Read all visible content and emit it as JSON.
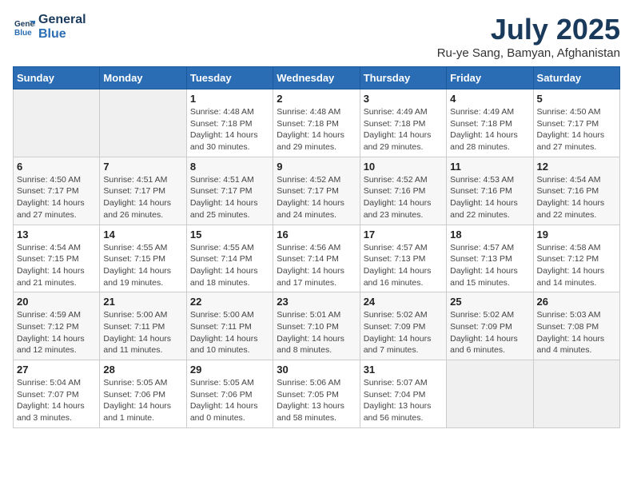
{
  "header": {
    "logo_line1": "General",
    "logo_line2": "Blue",
    "title": "July 2025",
    "subtitle": "Ru-ye Sang, Bamyan, Afghanistan"
  },
  "weekdays": [
    "Sunday",
    "Monday",
    "Tuesday",
    "Wednesday",
    "Thursday",
    "Friday",
    "Saturday"
  ],
  "weeks": [
    [
      {
        "num": "",
        "detail": ""
      },
      {
        "num": "",
        "detail": ""
      },
      {
        "num": "1",
        "detail": "Sunrise: 4:48 AM\nSunset: 7:18 PM\nDaylight: 14 hours\nand 30 minutes."
      },
      {
        "num": "2",
        "detail": "Sunrise: 4:48 AM\nSunset: 7:18 PM\nDaylight: 14 hours\nand 29 minutes."
      },
      {
        "num": "3",
        "detail": "Sunrise: 4:49 AM\nSunset: 7:18 PM\nDaylight: 14 hours\nand 29 minutes."
      },
      {
        "num": "4",
        "detail": "Sunrise: 4:49 AM\nSunset: 7:18 PM\nDaylight: 14 hours\nand 28 minutes."
      },
      {
        "num": "5",
        "detail": "Sunrise: 4:50 AM\nSunset: 7:17 PM\nDaylight: 14 hours\nand 27 minutes."
      }
    ],
    [
      {
        "num": "6",
        "detail": "Sunrise: 4:50 AM\nSunset: 7:17 PM\nDaylight: 14 hours\nand 27 minutes."
      },
      {
        "num": "7",
        "detail": "Sunrise: 4:51 AM\nSunset: 7:17 PM\nDaylight: 14 hours\nand 26 minutes."
      },
      {
        "num": "8",
        "detail": "Sunrise: 4:51 AM\nSunset: 7:17 PM\nDaylight: 14 hours\nand 25 minutes."
      },
      {
        "num": "9",
        "detail": "Sunrise: 4:52 AM\nSunset: 7:17 PM\nDaylight: 14 hours\nand 24 minutes."
      },
      {
        "num": "10",
        "detail": "Sunrise: 4:52 AM\nSunset: 7:16 PM\nDaylight: 14 hours\nand 23 minutes."
      },
      {
        "num": "11",
        "detail": "Sunrise: 4:53 AM\nSunset: 7:16 PM\nDaylight: 14 hours\nand 22 minutes."
      },
      {
        "num": "12",
        "detail": "Sunrise: 4:54 AM\nSunset: 7:16 PM\nDaylight: 14 hours\nand 22 minutes."
      }
    ],
    [
      {
        "num": "13",
        "detail": "Sunrise: 4:54 AM\nSunset: 7:15 PM\nDaylight: 14 hours\nand 21 minutes."
      },
      {
        "num": "14",
        "detail": "Sunrise: 4:55 AM\nSunset: 7:15 PM\nDaylight: 14 hours\nand 19 minutes."
      },
      {
        "num": "15",
        "detail": "Sunrise: 4:55 AM\nSunset: 7:14 PM\nDaylight: 14 hours\nand 18 minutes."
      },
      {
        "num": "16",
        "detail": "Sunrise: 4:56 AM\nSunset: 7:14 PM\nDaylight: 14 hours\nand 17 minutes."
      },
      {
        "num": "17",
        "detail": "Sunrise: 4:57 AM\nSunset: 7:13 PM\nDaylight: 14 hours\nand 16 minutes."
      },
      {
        "num": "18",
        "detail": "Sunrise: 4:57 AM\nSunset: 7:13 PM\nDaylight: 14 hours\nand 15 minutes."
      },
      {
        "num": "19",
        "detail": "Sunrise: 4:58 AM\nSunset: 7:12 PM\nDaylight: 14 hours\nand 14 minutes."
      }
    ],
    [
      {
        "num": "20",
        "detail": "Sunrise: 4:59 AM\nSunset: 7:12 PM\nDaylight: 14 hours\nand 12 minutes."
      },
      {
        "num": "21",
        "detail": "Sunrise: 5:00 AM\nSunset: 7:11 PM\nDaylight: 14 hours\nand 11 minutes."
      },
      {
        "num": "22",
        "detail": "Sunrise: 5:00 AM\nSunset: 7:11 PM\nDaylight: 14 hours\nand 10 minutes."
      },
      {
        "num": "23",
        "detail": "Sunrise: 5:01 AM\nSunset: 7:10 PM\nDaylight: 14 hours\nand 8 minutes."
      },
      {
        "num": "24",
        "detail": "Sunrise: 5:02 AM\nSunset: 7:09 PM\nDaylight: 14 hours\nand 7 minutes."
      },
      {
        "num": "25",
        "detail": "Sunrise: 5:02 AM\nSunset: 7:09 PM\nDaylight: 14 hours\nand 6 minutes."
      },
      {
        "num": "26",
        "detail": "Sunrise: 5:03 AM\nSunset: 7:08 PM\nDaylight: 14 hours\nand 4 minutes."
      }
    ],
    [
      {
        "num": "27",
        "detail": "Sunrise: 5:04 AM\nSunset: 7:07 PM\nDaylight: 14 hours\nand 3 minutes."
      },
      {
        "num": "28",
        "detail": "Sunrise: 5:05 AM\nSunset: 7:06 PM\nDaylight: 14 hours\nand 1 minute."
      },
      {
        "num": "29",
        "detail": "Sunrise: 5:05 AM\nSunset: 7:06 PM\nDaylight: 14 hours\nand 0 minutes."
      },
      {
        "num": "30",
        "detail": "Sunrise: 5:06 AM\nSunset: 7:05 PM\nDaylight: 13 hours\nand 58 minutes."
      },
      {
        "num": "31",
        "detail": "Sunrise: 5:07 AM\nSunset: 7:04 PM\nDaylight: 13 hours\nand 56 minutes."
      },
      {
        "num": "",
        "detail": ""
      },
      {
        "num": "",
        "detail": ""
      }
    ]
  ]
}
